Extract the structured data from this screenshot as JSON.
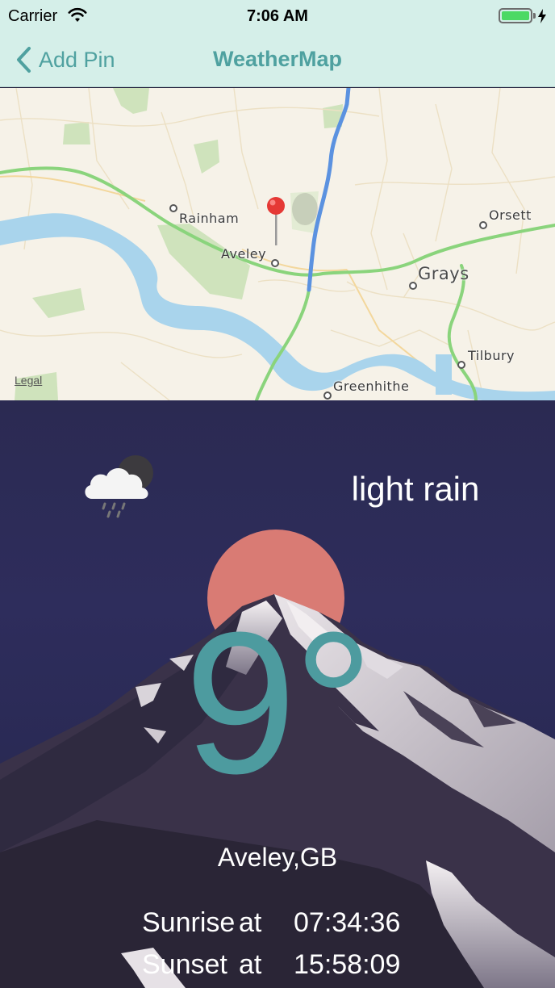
{
  "status_bar": {
    "carrier": "Carrier",
    "time": "7:06 AM",
    "battery_level": 1.0,
    "charging": true
  },
  "nav": {
    "back_label": "Add Pin",
    "title": "WeatherMap",
    "accent_color": "#4fa1a0"
  },
  "map": {
    "legal": "Legal",
    "places": {
      "rainham": "Rainham",
      "aveley": "Aveley",
      "grays": "Grays",
      "orsett": "Orsett",
      "tilbury": "Tilbury",
      "greenhithe": "Greenhithe"
    },
    "pin_color": "#e53935"
  },
  "weather": {
    "condition": "light rain",
    "condition_icon": "cloud-rain-night-icon",
    "temperature": "9",
    "degree_symbol": "°",
    "location": "Aveley,GB",
    "sunrise_label": "Sunrise",
    "sunset_label": "Sunset",
    "at_label": "at",
    "sunrise": "07:34:36",
    "sunset": "15:58:09",
    "temp_color": "#4d9b9f",
    "sun_color": "#d97b74"
  }
}
